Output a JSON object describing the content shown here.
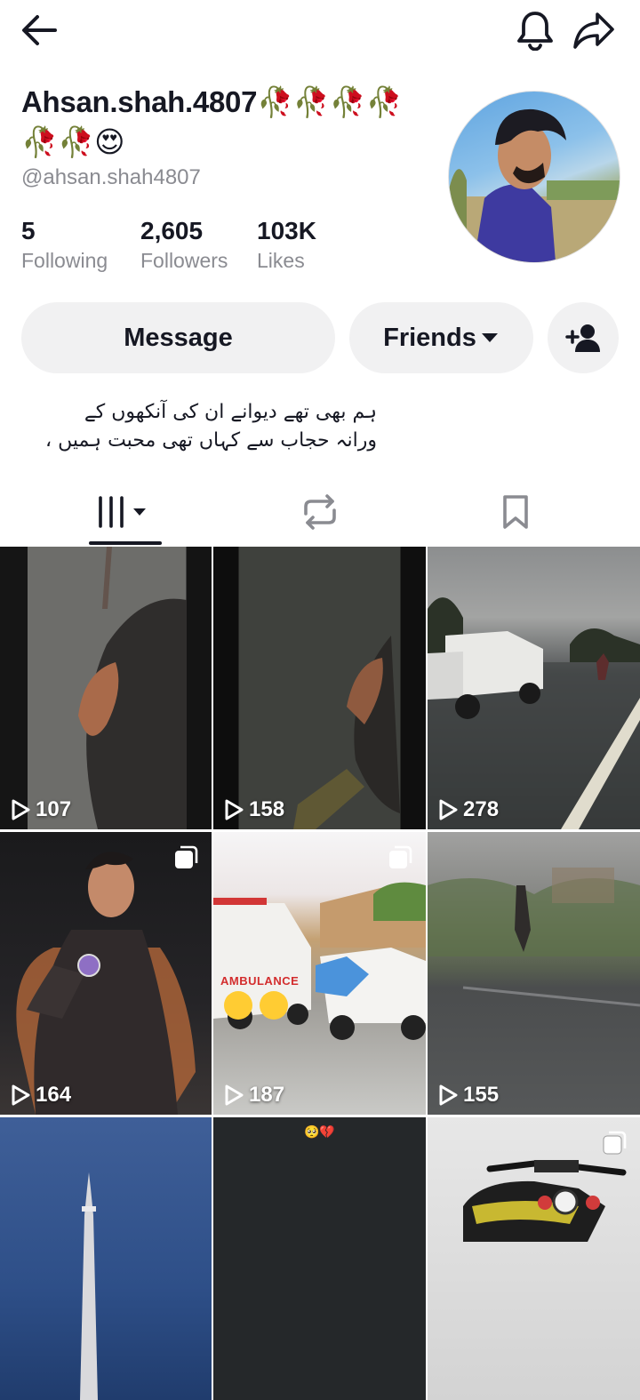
{
  "header": {
    "back_icon": "arrow-left-icon",
    "bell_icon": "bell-icon",
    "share_icon": "share-arrow-icon"
  },
  "profile": {
    "display_name": "Ahsan.shah.4807🥀🥀🥀🥀",
    "display_name_cont": "🥀🥀😍",
    "username": "@ahsan.shah4807",
    "stats": [
      {
        "value": "5",
        "label": "Following"
      },
      {
        "value": "2,605",
        "label": "Followers"
      },
      {
        "value": "103K",
        "label": "Likes"
      }
    ],
    "bio": "ہم بھی تھے دیوانے ان کی آنکھوں کے\nورانہ حجاب سے کہاں تھی محبت ہمیں ،"
  },
  "actions": {
    "message_label": "Message",
    "friends_label": "Friends",
    "add_friend_icon": "add-user-icon"
  },
  "tabs": [
    {
      "icon": "videos-grid-icon",
      "selected": true
    },
    {
      "icon": "repost-icon",
      "selected": false
    },
    {
      "icon": "bookmark-icon",
      "selected": false
    }
  ],
  "videos": [
    {
      "views": "107"
    },
    {
      "views": "158"
    },
    {
      "views": "278"
    },
    {
      "views": "164"
    },
    {
      "views": "187"
    },
    {
      "views": "155"
    },
    {
      "views": ""
    },
    {
      "views": ""
    },
    {
      "views": ""
    }
  ],
  "video_overlay_text": {
    "ambulance": "AMBULANCE",
    "tile8_emoji": "🥺💔"
  },
  "colors": {
    "text_primary": "#161823",
    "text_secondary": "#8a8b91",
    "button_bg": "#f1f1f2"
  }
}
